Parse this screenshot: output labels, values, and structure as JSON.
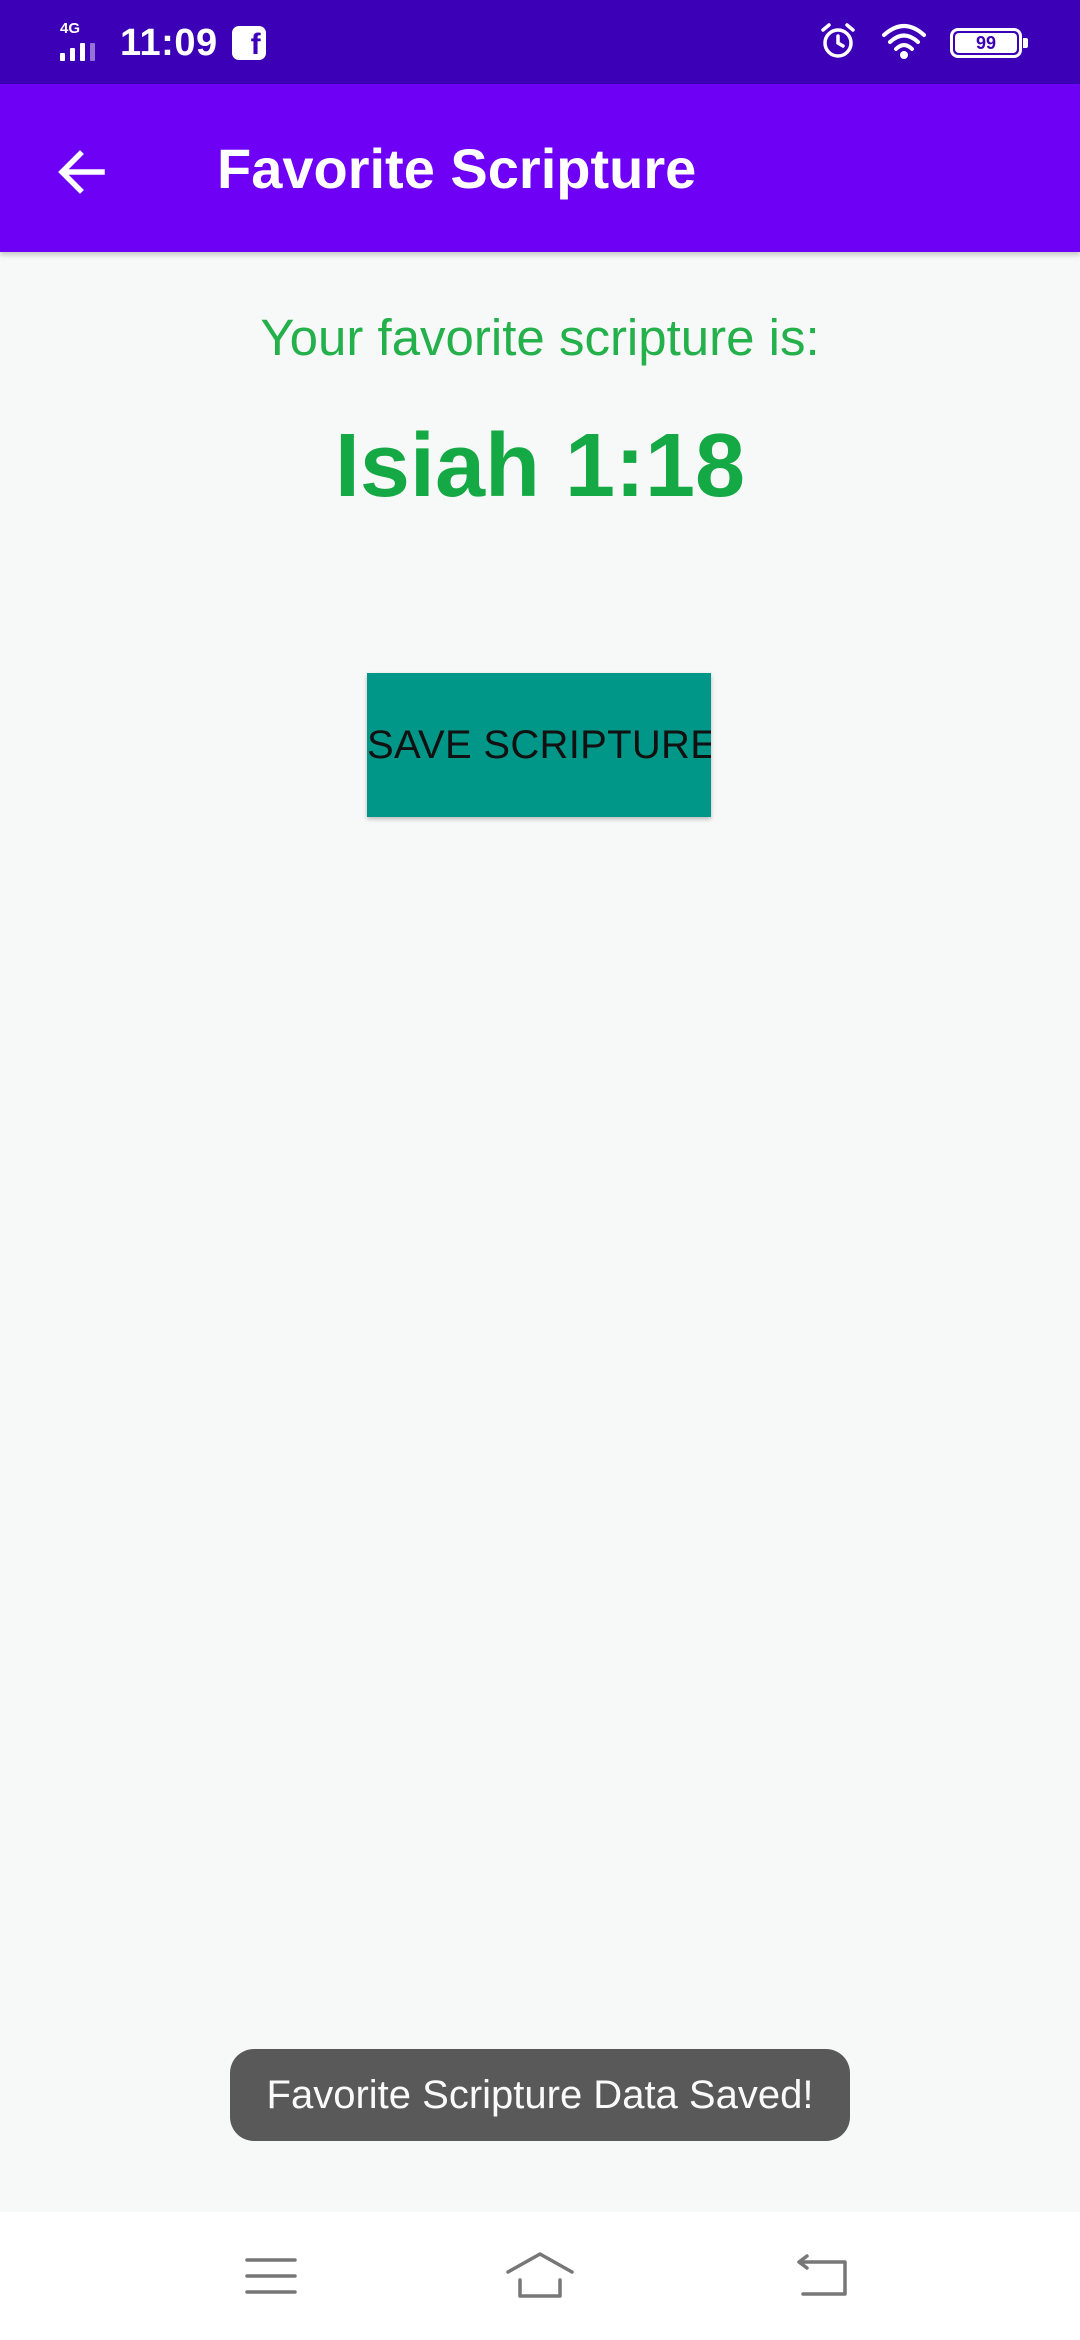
{
  "status_bar": {
    "network": "4G",
    "time": "11:09",
    "battery": "99",
    "icons": [
      "signal-icon",
      "facebook-icon",
      "alarm-icon",
      "wifi-icon",
      "battery-icon"
    ]
  },
  "app_bar": {
    "title": "Favorite Scripture",
    "back_icon": "arrow-left-icon",
    "color": "#6f00f6"
  },
  "content": {
    "subtitle": "Your favorite scripture is:",
    "scripture": "Isiah 1:18",
    "save_button_label": "SAVE SCRIPTURE",
    "accent_color": "#14a944",
    "button_color": "#009688"
  },
  "toast": {
    "message": "Favorite Scripture Data Saved!"
  },
  "nav_bar": {
    "icons": [
      "menu-icon",
      "home-icon",
      "back-icon"
    ]
  }
}
